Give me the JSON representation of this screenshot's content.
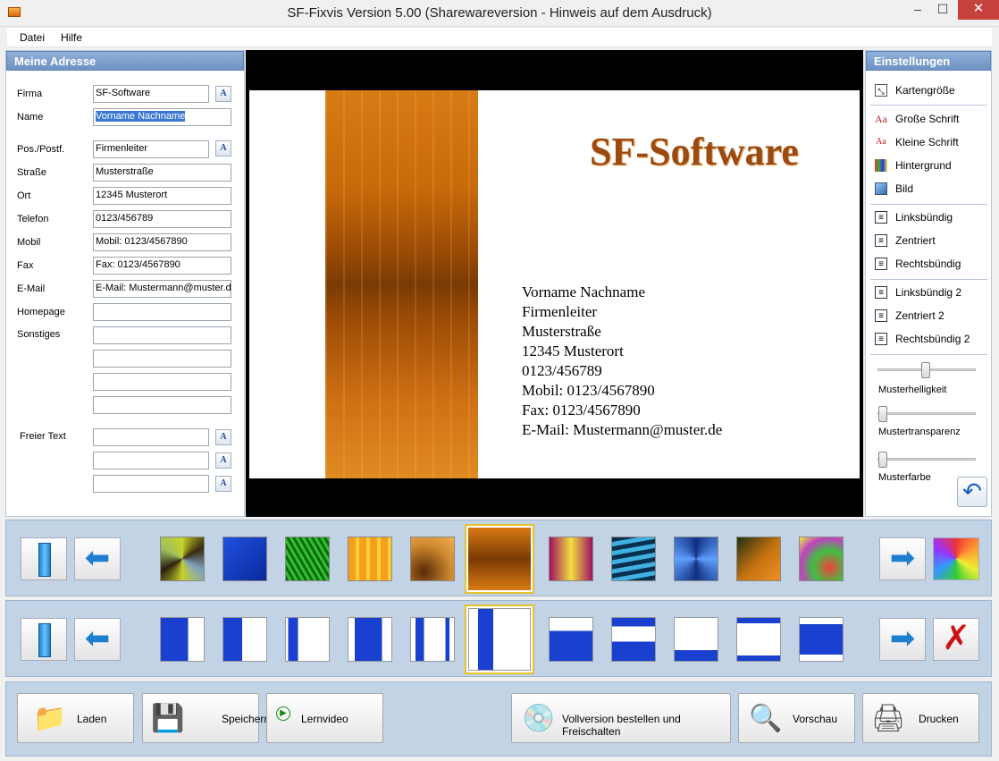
{
  "window": {
    "title": "SF-Fixvis  Version 5.00 (Sharewareversion - Hinweis auf dem Ausdruck)",
    "minimize": "–",
    "maximize": "☐",
    "close": "✕"
  },
  "menu": {
    "file": "Datei",
    "help": "Hilfe"
  },
  "left": {
    "header": "Meine Adresse",
    "fields": [
      {
        "label": "Firma",
        "value": "SF-Software"
      },
      {
        "label": "Name",
        "value": "Vorname Nachname"
      },
      {
        "label": "Pos./Postf.",
        "value": "Firmenleiter"
      },
      {
        "label": "Straße",
        "value": "Musterstraße"
      },
      {
        "label": "Ort",
        "value": "12345 Musterort"
      },
      {
        "label": "Telefon",
        "value": "0123/456789"
      },
      {
        "label": "Mobil",
        "value": "Mobil: 0123/4567890"
      },
      {
        "label": "Fax",
        "value": "Fax: 0123/4567890"
      },
      {
        "label": "E-Mail",
        "value": "E-Mail: Mustermann@muster.de"
      },
      {
        "label": "Homepage",
        "value": ""
      },
      {
        "label": "Sonstiges",
        "value": ""
      }
    ],
    "free_text_label": "Freier Text",
    "font_button": "A"
  },
  "card": {
    "company": "SF-Software",
    "lines": [
      "Vorname Nachname",
      "Firmenleiter",
      "Musterstraße",
      "12345 Musterort",
      "0123/456789",
      "Mobil: 0123/4567890",
      "Fax: 0123/4567890",
      "E-Mail:  Mustermann@muster.de"
    ]
  },
  "right": {
    "header": "Einstellungen",
    "items": [
      "Kartengröße",
      "Große Schrift",
      "Kleine Schrift",
      "Hintergrund",
      "Bild",
      "Linksbündig",
      "Zentriert",
      "Rechtsbündig",
      "Linksbündig 2",
      "Zentriert 2",
      "Rechtsbündig 2"
    ],
    "sliders": [
      "Musterhelligkeit",
      "Mustertransparenz",
      "Musterfarbe"
    ],
    "slider_values": [
      0.5,
      0.0,
      0.0
    ]
  },
  "bottom": {
    "load": "Laden",
    "save": "Speichern",
    "video": "Lernvideo",
    "order": "Vollversion bestellen und Freischalten",
    "preview": "Vorschau",
    "print": "Drucken"
  },
  "colors": {
    "accent": "#6d92c3",
    "selection": "#e3c22a",
    "card_title": "#9b4a12"
  }
}
